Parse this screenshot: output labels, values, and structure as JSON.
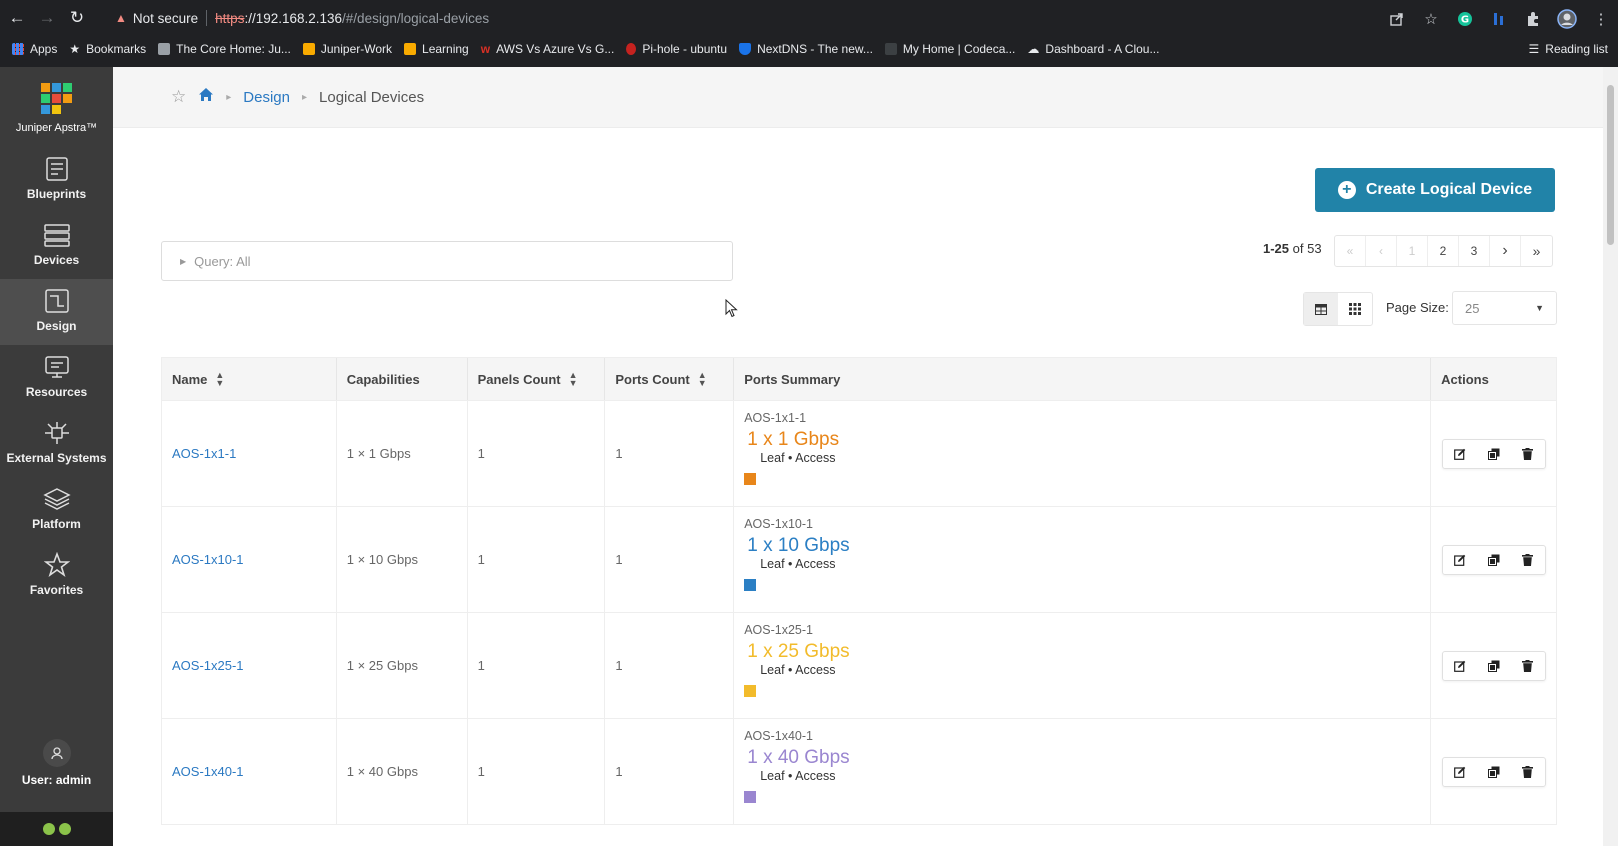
{
  "browser": {
    "security_label": "Not secure",
    "url_scheme": "https",
    "url_host": "://192.168.2.136",
    "url_path": "/#/design/logical-devices",
    "bookmarks": [
      {
        "label": "Apps",
        "color": "#4285f4"
      },
      {
        "label": "Bookmarks",
        "color": "#e8eaed"
      },
      {
        "label": "The Core Home: Ju...",
        "color": "#9aa0a6"
      },
      {
        "label": "Juniper-Work",
        "color": "#f9ab00"
      },
      {
        "label": "Learning",
        "color": "#f9ab00"
      },
      {
        "label": "AWS Vs Azure Vs G...",
        "color": "#d93025"
      },
      {
        "label": "Pi-hole - ubuntu",
        "color": "#c5221f"
      },
      {
        "label": "NextDNS - The new...",
        "color": "#1a73e8"
      },
      {
        "label": "My Home | Codeca...",
        "color": "#3c4043"
      },
      {
        "label": "Dashboard - A Clou...",
        "color": "#e8eaed"
      }
    ],
    "reading_list": "Reading list"
  },
  "sidebar": {
    "brand": "Juniper Apstra™",
    "items": [
      {
        "label": "Blueprints"
      },
      {
        "label": "Devices"
      },
      {
        "label": "Design"
      },
      {
        "label": "Resources"
      },
      {
        "label": "External Systems"
      },
      {
        "label": "Platform"
      },
      {
        "label": "Favorites"
      }
    ],
    "user": "User: admin"
  },
  "breadcrumb": {
    "parent": "Design",
    "current": "Logical Devices"
  },
  "create_button": "Create Logical Device",
  "query": "Query: All",
  "pagination": {
    "range": "1-25",
    "of_label": "of",
    "total": "53",
    "pages": [
      "1",
      "2",
      "3"
    ]
  },
  "page_size": {
    "label": "Page Size:",
    "value": "25"
  },
  "table": {
    "headers": {
      "name": "Name",
      "capabilities": "Capabilities",
      "panels": "Panels Count",
      "ports": "Ports Count",
      "summary": "Ports Summary",
      "actions": "Actions"
    },
    "rows": [
      {
        "name": "AOS-1x1-1",
        "capabilities": "1 × 1 Gbps",
        "panels": "1",
        "ports": "1",
        "summary_title": "AOS-1x1-1",
        "speed": "1 x 1 Gbps",
        "roles": "Leaf • Access",
        "color": "#e8861a"
      },
      {
        "name": "AOS-1x10-1",
        "capabilities": "1 × 10 Gbps",
        "panels": "1",
        "ports": "1",
        "summary_title": "AOS-1x10-1",
        "speed": "1 x 10 Gbps",
        "roles": "Leaf • Access",
        "color": "#2b7fc4"
      },
      {
        "name": "AOS-1x25-1",
        "capabilities": "1 × 25 Gbps",
        "panels": "1",
        "ports": "1",
        "summary_title": "AOS-1x25-1",
        "speed": "1 x 25 Gbps",
        "roles": "Leaf • Access",
        "color": "#f2bb2b"
      },
      {
        "name": "AOS-1x40-1",
        "capabilities": "1 × 40 Gbps",
        "panels": "1",
        "ports": "1",
        "summary_title": "AOS-1x40-1",
        "speed": "1 x 40 Gbps",
        "roles": "Leaf • Access",
        "color": "#9a86d0"
      }
    ]
  }
}
